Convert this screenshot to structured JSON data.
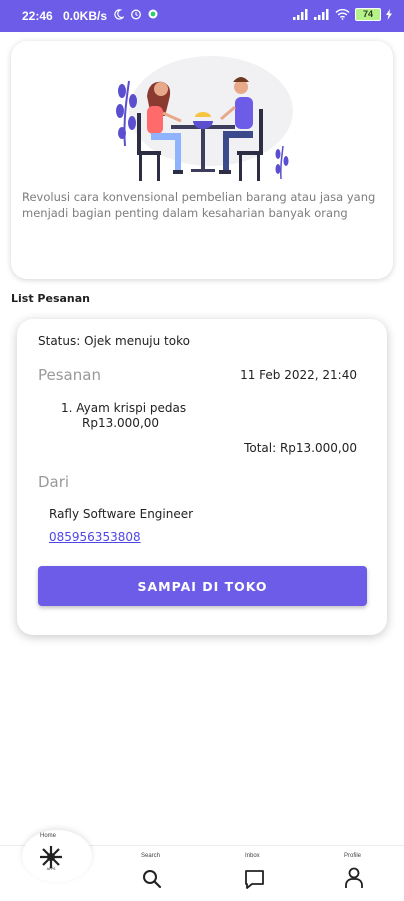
{
  "status_bar": {
    "time": "22:46",
    "network_speed": "0.0KB/s",
    "battery": "74"
  },
  "hero": {
    "description": "Revolusi cara konvensional pembelian barang atau jasa yang menjadi bagian penting dalam kesaharian banyak orang"
  },
  "section_title": "List Pesanan",
  "order": {
    "status": "Status: Ojek menuju toko",
    "heading": "Pesanan",
    "date": "11 Feb 2022, 21:40",
    "items": [
      {
        "name": "1. Ayam krispi pedas",
        "price": "Rp13.000,00"
      }
    ],
    "total": "Total: Rp13.000,00",
    "from_heading": "Dari",
    "sender_name": "Rafly Software Engineer",
    "sender_phone": "085956353808",
    "action_label": "SAMPAI DI TOKO"
  },
  "bottom_nav": {
    "home_label": "Home",
    "logo_text": "APPS",
    "search_label": "Search",
    "inbox_label": "Inbox",
    "profile_label": "Profile"
  },
  "colors": {
    "primary": "#6c5ce7",
    "link": "#4f46e5",
    "muted_text": "#7d7d7d"
  }
}
